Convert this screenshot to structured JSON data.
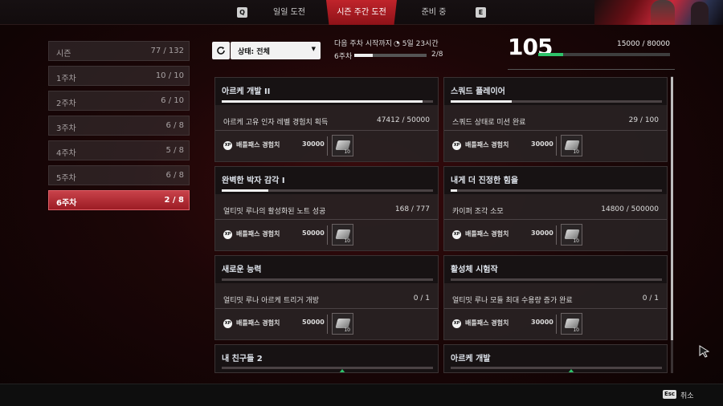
{
  "topbar": {
    "left_key": "Q",
    "right_key": "E",
    "tabs": [
      {
        "label": "일일 도전",
        "active": false
      },
      {
        "label": "시즌 주간 도전",
        "active": true
      },
      {
        "label": "준비 중",
        "active": false
      }
    ]
  },
  "sidebar": {
    "items": [
      {
        "label": "시즌",
        "value": "77 / 132",
        "active": false
      },
      {
        "label": "1주차",
        "value": "10 / 10",
        "active": false
      },
      {
        "label": "2주차",
        "value": "6 / 10",
        "active": false
      },
      {
        "label": "3주차",
        "value": "6 / 8",
        "active": false
      },
      {
        "label": "4주차",
        "value": "5 / 8",
        "active": false
      },
      {
        "label": "5주차",
        "value": "6 / 8",
        "active": false
      },
      {
        "label": "6주차",
        "value": "2 / 8",
        "active": true
      }
    ]
  },
  "filter": {
    "status_label": "상태: 전체",
    "reset_label": "다음 주차 시작까지",
    "timer": "5일 23시간",
    "week_label": "6주차",
    "week_value": "2/8",
    "week_progress": 0.25
  },
  "level": {
    "number": "105",
    "xp_value": "15000 / 80000",
    "xp_progress": 0.1875
  },
  "cards": [
    {
      "title": "아르케 개발 II",
      "progress": 0.95,
      "mission": "아르케 고유 인자 레벨 경험치 획득",
      "mission_value": "47412 / 50000",
      "reward_label": "배틀패스 경험치",
      "reward_amount": "30000",
      "item_count": "10"
    },
    {
      "title": "스쿼드 플레이어",
      "progress": 0.29,
      "mission": "스쿼드 상태로 미션 완료",
      "mission_value": "29 / 100",
      "reward_label": "배틀패스 경험치",
      "reward_amount": "30000",
      "item_count": "10"
    },
    {
      "title": "완벽한 박자 감각 Ⅰ",
      "progress": 0.22,
      "mission": "얼티밋 루나의 활성화된 노트 성공",
      "mission_value": "168 / 777",
      "reward_label": "배틀패스 경험치",
      "reward_amount": "50000",
      "item_count": "10"
    },
    {
      "title": "내게 더 진정한 힘을",
      "progress": 0.03,
      "mission": "카이퍼 조각 소모",
      "mission_value": "14800 / 500000",
      "reward_label": "배틀패스 경험치",
      "reward_amount": "30000",
      "item_count": "10"
    },
    {
      "title": "새로운 능력",
      "progress": 0.0,
      "mission": "얼티밋 루나 아르케 트리거 개방",
      "mission_value": "0 / 1",
      "reward_label": "배틀패스 경험치",
      "reward_amount": "50000",
      "item_count": "10"
    },
    {
      "title": "활성체 시험작",
      "progress": 0.0,
      "mission": "얼티밋 루나 모듈 최대 수용량 증가 완료",
      "mission_value": "0 / 1",
      "reward_label": "배틀패스 경험치",
      "reward_amount": "30000",
      "item_count": "10"
    },
    {
      "title": "내 친구들 2",
      "progress": 0.0
    },
    {
      "title": "아르케 개발",
      "progress": 0.0
    }
  ],
  "bottom": {
    "esc_key": "Esc",
    "esc_label": "취소"
  },
  "icons": {
    "refresh": "refresh-icon",
    "timer": "clock-icon",
    "xp": "xp-badge-icon",
    "item": "chip-item-icon",
    "cursor": "mouse-cursor-icon"
  },
  "colors": {
    "accent_red": "#c0242b",
    "xp_green": "#2ec36a"
  }
}
